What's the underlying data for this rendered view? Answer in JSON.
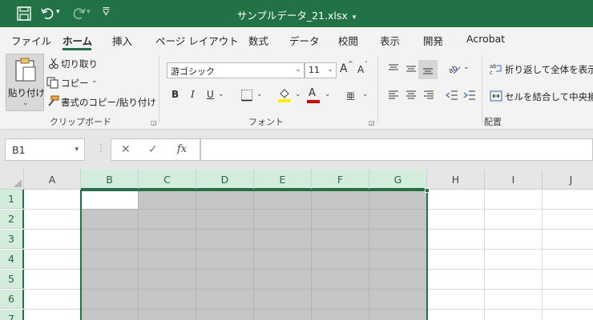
{
  "titlebar": {
    "title": "サンプルデータ_21.xlsx",
    "title_caret": "▾",
    "qat_more": "⩢"
  },
  "tabs": [
    {
      "label": "ファイル"
    },
    {
      "label": "ホーム"
    },
    {
      "label": "挿入"
    },
    {
      "label": "ページ レイアウト"
    },
    {
      "label": "数式"
    },
    {
      "label": "データ"
    },
    {
      "label": "校閲"
    },
    {
      "label": "表示"
    },
    {
      "label": "開発"
    },
    {
      "label": "Acrobat"
    }
  ],
  "active_tab": "ホーム",
  "clipboard": {
    "paste_label": "貼り付け",
    "cut_label": "切り取り",
    "copy_label": "コピー",
    "format_painter_label": "書式のコピー/貼り付け",
    "group_label": "クリップボード"
  },
  "font": {
    "font_name": "游ゴシック",
    "font_size": "11",
    "grow_label": "A",
    "shrink_label": "A",
    "bold": "B",
    "italic": "I",
    "underline": "U",
    "font_color_label": "A",
    "phonetic_label": "亜",
    "group_label": "フォント"
  },
  "alignment": {
    "wrap_text_label": "折り返して全体を表示す",
    "merge_center_label": "セルを結合して中央揃え",
    "group_label": "配置"
  },
  "formula_bar": {
    "name_box": "B1",
    "cancel": "✕",
    "enter": "✓",
    "fx": "fx",
    "value": ""
  },
  "grid": {
    "columns": [
      "A",
      "B",
      "C",
      "D",
      "E",
      "F",
      "G",
      "H",
      "I",
      "J"
    ],
    "selected_columns": [
      "B",
      "C",
      "D",
      "E",
      "F",
      "G"
    ],
    "rows": [
      "1",
      "2",
      "3",
      "4",
      "5",
      "6",
      "7"
    ],
    "active_cell": "B1",
    "selection_range": "B1:G7"
  },
  "colors": {
    "accent": "#217346",
    "selection_fill": "#c6c6c6",
    "header_selected": "#d3ecdb"
  }
}
